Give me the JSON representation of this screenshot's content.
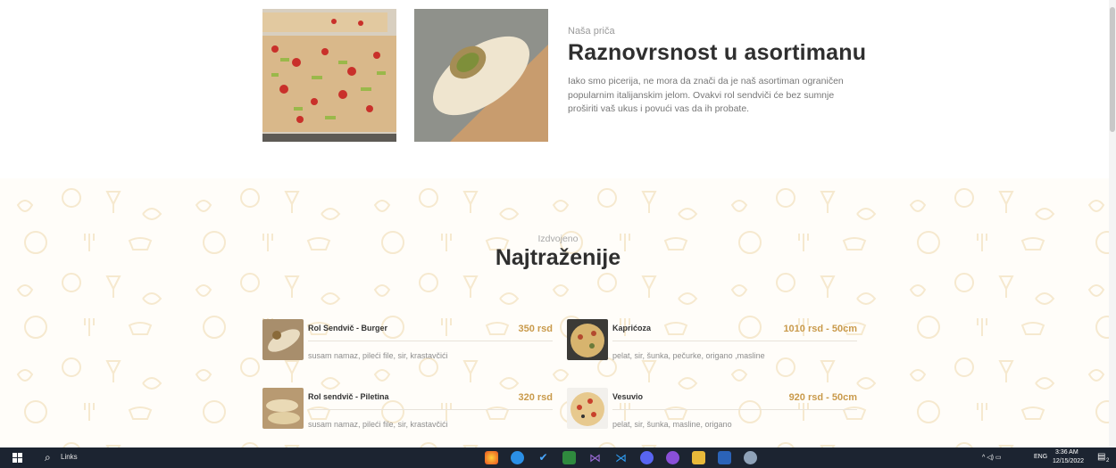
{
  "story": {
    "eyebrow": "Naša priča",
    "title": "Raznovrsnost u asortimanu",
    "body": "Iako smo picerija, ne mora da znači da je naš asortiman ograničen popularnim italijanskim jelom. Ovakvi rol sendviči će bez sumnje proširiti vaš ukus i povući vas da ih probate."
  },
  "featured": {
    "eyebrow": "Izdvojeno",
    "title": "Najtraženije",
    "items": [
      {
        "name": "Rol Sendvič - Burger",
        "price": "350 rsd",
        "desc": "susam namaz, pileći file, sir, krastavčići"
      },
      {
        "name": "Kaprićoza",
        "price": "1010 rsd - 50cm",
        "desc": "pelat, sir, šunka, pečurke, origano ,masline"
      },
      {
        "name": "Rol sendvič - Piletina",
        "price": "320 rsd",
        "desc": "susam namaz, pileći file, sir, krastavčići"
      },
      {
        "name": "Vesuvio",
        "price": "920 rsd - 50cm",
        "desc": "pelat, sir, šunka, masline, origano"
      }
    ]
  },
  "taskbar": {
    "search_label": "Links",
    "language": "ENG",
    "time": "3:36 AM",
    "date": "12/15/2022",
    "notification_count": "2",
    "icons": [
      "firefox-icon",
      "app-icon",
      "visual-studio-code-icon",
      "nvidia-icon",
      "visual-studio-icon",
      "vscode-icon",
      "discord-icon",
      "github-icon",
      "file-explorer-icon",
      "word-icon",
      "paint-icon"
    ]
  },
  "colors": {
    "accent": "#c99a4b",
    "taskbar": "#1c2431"
  }
}
